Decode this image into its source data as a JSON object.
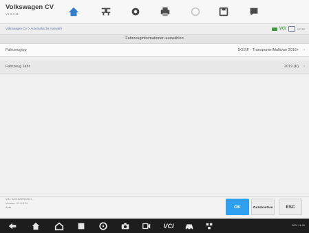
{
  "header": {
    "title": "Volkswagen CV",
    "subtitle": "V1.0.0.11",
    "toolbar_icons": [
      "home-icon",
      "vehicle-swap-icon",
      "settings-icon",
      "print-icon",
      "help-icon",
      "save-icon",
      "data-logging-icon"
    ]
  },
  "breadcrumb": {
    "path": "Volkswagen CV > Automatische Auswahl",
    "vci_label": "VCI",
    "time": "12:30"
  },
  "section": {
    "title": "Fahrzeuginformationen auswählen"
  },
  "rows": [
    {
      "label": "Fahrzeugtyp",
      "value": "SG/SF - Transporter/Multivan 2016+"
    },
    {
      "label": "Fahrzeug Jahr",
      "value": "2019 (K)"
    }
  ],
  "footer": {
    "info_line1": "VIN: WV1ZZZ7HZKH...",
    "info_line2": "Version: V1.0.0.11",
    "info_line3": "Auto",
    "ok_label": "OK",
    "back_label": "Zurücksetzen",
    "esc_label": "ESC"
  },
  "navbar": {
    "vci_label": "VCI",
    "status_text": "96% 11:45"
  },
  "colors": {
    "accent": "#2ea0ee",
    "vci_green": "#3f9b3a",
    "navbar": "#1d1d1d"
  }
}
